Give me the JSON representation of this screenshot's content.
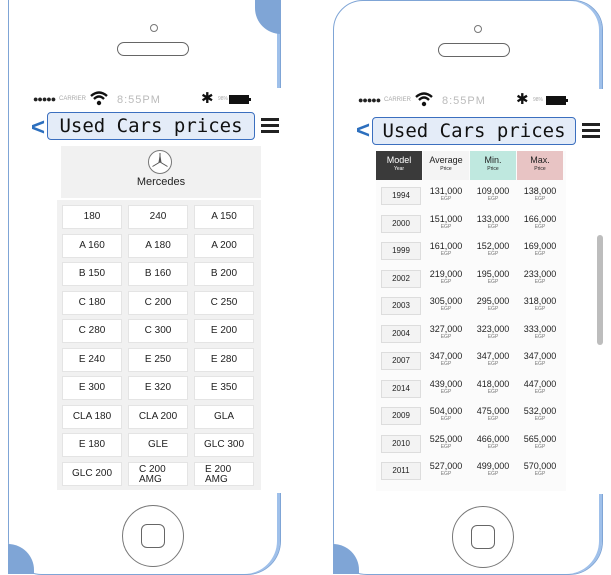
{
  "status": {
    "carrier": "CARRIER",
    "time": "8:55PM",
    "battery_pct": "98%"
  },
  "left": {
    "title": "Used Cars prices",
    "brand": "Mercedes",
    "models": [
      [
        "180",
        "240",
        "A 150"
      ],
      [
        "A 160",
        "A 180",
        "A 200"
      ],
      [
        "B 150",
        "B 160",
        "B 200"
      ],
      [
        "C 180",
        "C 200",
        "C 250"
      ],
      [
        "C 280",
        "C 300",
        "E 200"
      ],
      [
        "E 240",
        "E 250",
        "E 280"
      ],
      [
        "E 300",
        "E 320",
        "E 350"
      ],
      [
        "CLA 180",
        "CLA 200",
        "GLA"
      ],
      [
        "E 180",
        "GLE",
        "GLC 300"
      ],
      [
        "GLC 200",
        "C 200\nAMG",
        "E 200\nAMG"
      ]
    ]
  },
  "right": {
    "title": "Used Cars prices",
    "headers": [
      {
        "label": "Model",
        "sub": "Year",
        "bg": "#3a3a3a",
        "color": "#ffffff"
      },
      {
        "label": "Average",
        "sub": "Price",
        "bg": "#f4f4f4",
        "color": "#222222"
      },
      {
        "label": "Min.",
        "sub": "Price",
        "bg": "#bfe8df",
        "color": "#222222"
      },
      {
        "label": "Max.",
        "sub": "Price",
        "bg": "#e8c4c4",
        "color": "#222222"
      }
    ],
    "unit": "EGP",
    "rows": [
      {
        "year": "1994",
        "avg": "131,000",
        "min": "109,000",
        "max": "138,000"
      },
      {
        "year": "2000",
        "avg": "151,000",
        "min": "133,000",
        "max": "166,000"
      },
      {
        "year": "1999",
        "avg": "161,000",
        "min": "152,000",
        "max": "169,000"
      },
      {
        "year": "2002",
        "avg": "219,000",
        "min": "195,000",
        "max": "233,000"
      },
      {
        "year": "2003",
        "avg": "305,000",
        "min": "295,000",
        "max": "318,000"
      },
      {
        "year": "2004",
        "avg": "327,000",
        "min": "323,000",
        "max": "333,000"
      },
      {
        "year": "2007",
        "avg": "347,000",
        "min": "347,000",
        "max": "347,000"
      },
      {
        "year": "2014",
        "avg": "439,000",
        "min": "418,000",
        "max": "447,000"
      },
      {
        "year": "2009",
        "avg": "504,000",
        "min": "475,000",
        "max": "532,000"
      },
      {
        "year": "2010",
        "avg": "525,000",
        "min": "466,000",
        "max": "565,000"
      },
      {
        "year": "2011",
        "avg": "527,000",
        "min": "499,000",
        "max": "570,000"
      }
    ]
  }
}
